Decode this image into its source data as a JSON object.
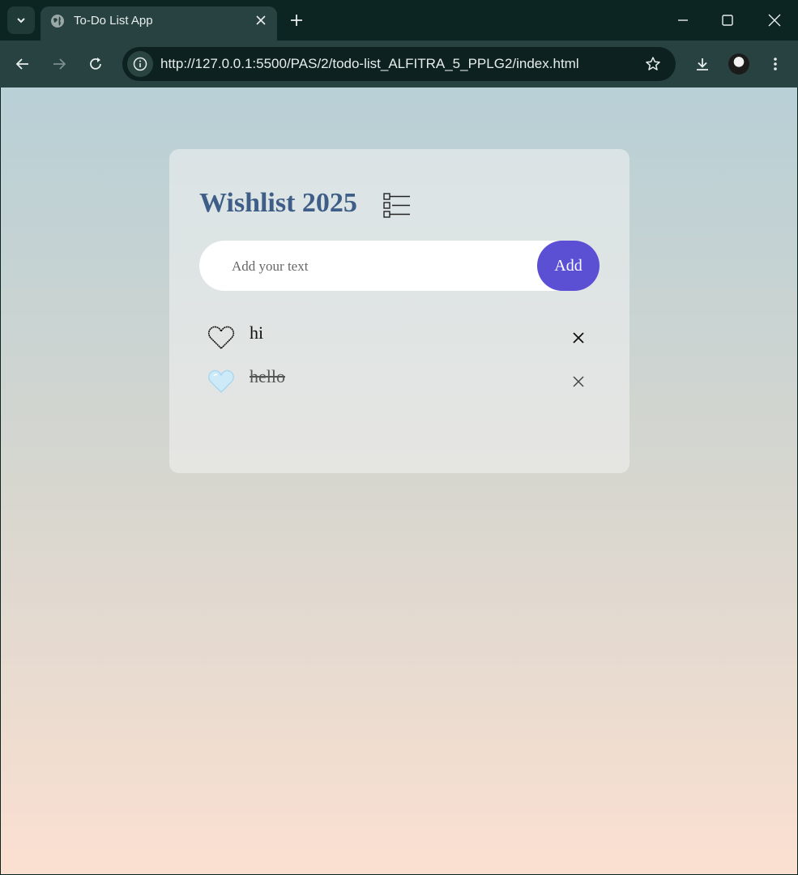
{
  "browser": {
    "tab_title": "To-Do List App",
    "url": "http://127.0.0.1:5500/PAS/2/todo-list_ALFITRA_5_PPLG2/index.html"
  },
  "app": {
    "title": "Wishlist 2025",
    "input_placeholder": "Add your text",
    "input_value": "",
    "add_label": "Add",
    "accent_color": "#5b4fd3",
    "title_color": "#3e5d87",
    "todos": [
      {
        "text": "hi",
        "done": false,
        "icon": "heart-outline-icon"
      },
      {
        "text": "hello",
        "done": true,
        "icon": "heart-filled-icon"
      }
    ],
    "remove_icon": "close-icon"
  }
}
